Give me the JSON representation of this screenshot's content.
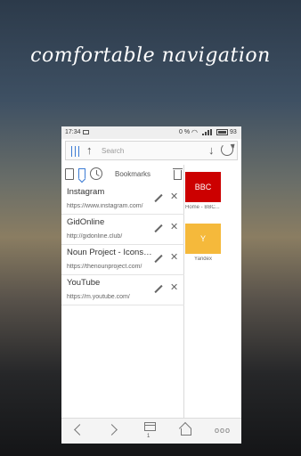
{
  "headline": "comfortable navigation",
  "status": {
    "time": "17:34",
    "battery_pct": "0 %",
    "battery_num": "93"
  },
  "search": {
    "placeholder": "Search",
    "menu_icon": "hamburger-menu-icon",
    "up_icon": "arrow-up-icon",
    "down_icon": "arrow-down-icon",
    "reload_icon": "reload-icon"
  },
  "bookmarks_panel": {
    "title": "Bookmarks",
    "items": [
      {
        "title": "Instagram",
        "url": "https://www.instagram.com/"
      },
      {
        "title": "GidOnline",
        "url": "http://gidonline.club/"
      },
      {
        "title": "Noun Project - Icons for...",
        "url": "https://thenounproject.com/"
      },
      {
        "title": "YouTube",
        "url": "https://m.youtube.com/"
      }
    ]
  },
  "speed_dial": [
    {
      "tile_text": "BBC",
      "label": "Home - BBC...",
      "color": "#cc0000"
    },
    {
      "tile_text": "Y",
      "label": "Yandex",
      "color": "#f5b93b"
    }
  ],
  "bottom_nav": {
    "tab_count": "1",
    "more": "ooo"
  },
  "colors": {
    "accent": "#3b7bd4"
  }
}
